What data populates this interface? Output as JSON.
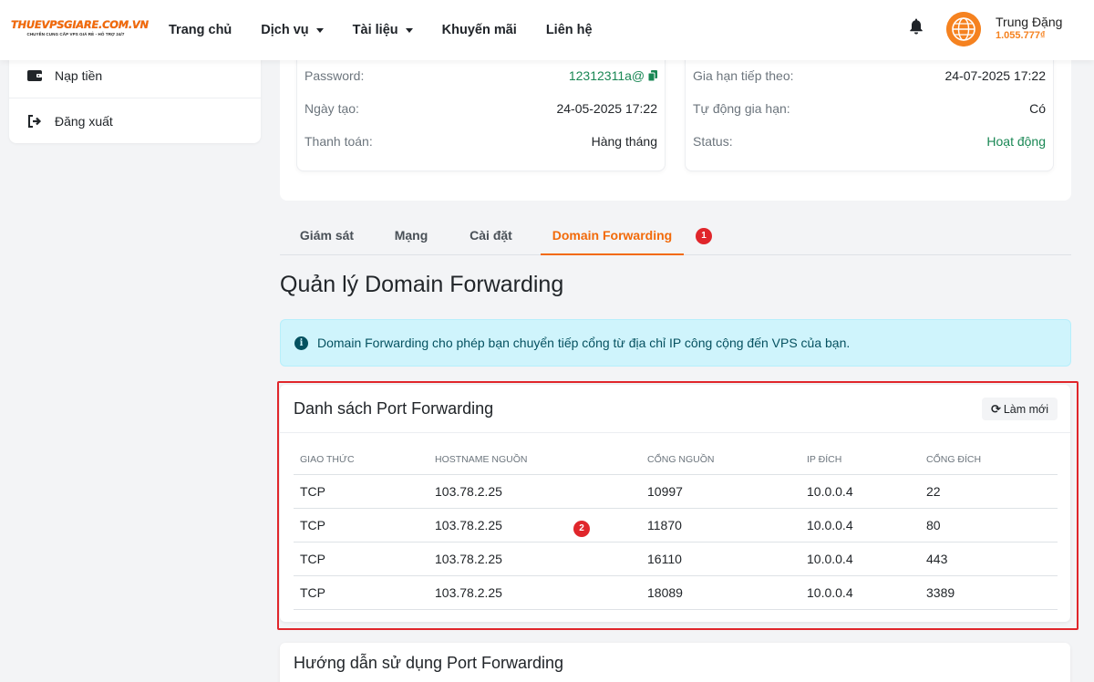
{
  "logo": {
    "brand": "THUEVPSGIARE.COM.VN",
    "tagline": "CHUYÊN CUNG CẤP VPS GIÁ RẺ - HỖ TRỢ 24/7"
  },
  "nav": {
    "items": [
      {
        "label": "Trang chủ",
        "dropdown": false
      },
      {
        "label": "Dịch vụ",
        "dropdown": true
      },
      {
        "label": "Tài liệu",
        "dropdown": true
      },
      {
        "label": "Khuyến mãi",
        "dropdown": false
      },
      {
        "label": "Liên hệ",
        "dropdown": false
      }
    ]
  },
  "user": {
    "name": "Trung Đặng",
    "balance": "1.055.777₫"
  },
  "sidebar": {
    "items": [
      {
        "label": "Nạp tiền",
        "icon": "wallet-icon"
      },
      {
        "label": "Đăng xuất",
        "icon": "sign-out-icon"
      }
    ]
  },
  "info_left": {
    "rows": [
      {
        "label": "Password:",
        "value": "12312311a@"
      },
      {
        "label": "Ngày tạo:",
        "value": "24-05-2025 17:22"
      },
      {
        "label": "Thanh toán:",
        "value": "Hàng tháng"
      }
    ]
  },
  "info_right": {
    "rows": [
      {
        "label": "Gia hạn tiếp theo:",
        "value": "24-07-2025 17:22"
      },
      {
        "label": "Tự động gia hạn:",
        "value": "Có"
      },
      {
        "label": "Status:",
        "value": "Hoạt động"
      }
    ]
  },
  "tabs": [
    {
      "label": "Giám sát",
      "active": false
    },
    {
      "label": "Mạng",
      "active": false
    },
    {
      "label": "Cài đặt",
      "active": false
    },
    {
      "label": "Domain Forwarding",
      "active": true
    }
  ],
  "annotations": [
    "1",
    "2"
  ],
  "page_title": "Quản lý Domain Forwarding",
  "alert_text": "Domain Forwarding cho phép bạn chuyển tiếp cổng từ địa chỉ IP công cộng đến VPS của bạn.",
  "port_list": {
    "title": "Danh sách Port Forwarding",
    "refresh_label": "Làm mới",
    "columns": [
      "GIAO THỨC",
      "HOSTNAME NGUỒN",
      "CỔNG NGUỒN",
      "IP ĐÍCH",
      "CỔNG ĐÍCH"
    ],
    "rows": [
      [
        "TCP",
        "103.78.2.25",
        "10997",
        "10.0.0.4",
        "22"
      ],
      [
        "TCP",
        "103.78.2.25",
        "11870",
        "10.0.0.4",
        "80"
      ],
      [
        "TCP",
        "103.78.2.25",
        "16110",
        "10.0.0.4",
        "443"
      ],
      [
        "TCP",
        "103.78.2.25",
        "18089",
        "10.0.0.4",
        "3389"
      ]
    ]
  },
  "guide_title": "Hướng dẫn sử dụng Port Forwarding",
  "colors": {
    "accent": "#f26a0a",
    "success": "#198754",
    "annotation": "#e0262b",
    "alert_bg": "#cff4fc"
  }
}
